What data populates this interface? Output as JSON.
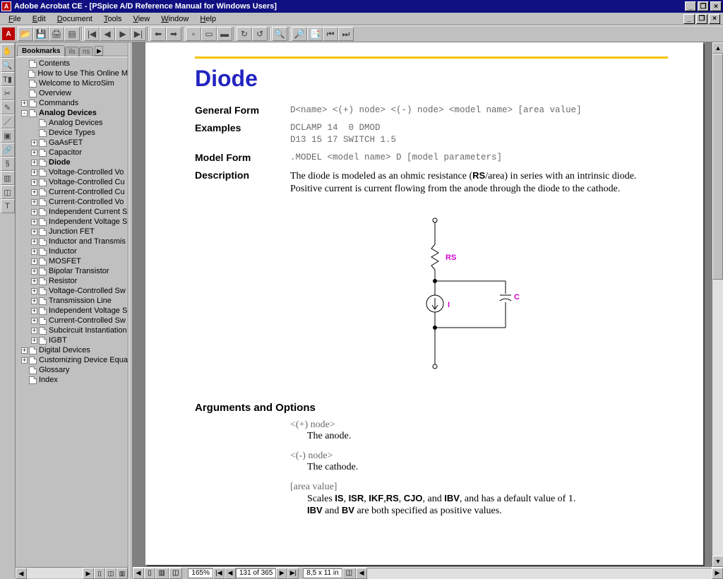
{
  "window": {
    "app": "Adobe Acrobat CE",
    "doc_title": "[PSpice A/D Reference Manual for Windows Users]"
  },
  "menus": [
    "File",
    "Edit",
    "Document",
    "Tools",
    "View",
    "Window",
    "Help"
  ],
  "toolbar_icons": [
    "open",
    "save",
    "print",
    "scan",
    "|",
    "first",
    "prev",
    "next",
    "last",
    "|",
    "back",
    "fwd",
    "|",
    "page",
    "fit",
    "fit-h",
    "|",
    "refresh",
    "refresh2",
    "|",
    "find",
    "|",
    "web1",
    "web2",
    "web3",
    "web4"
  ],
  "vtools": [
    "hand",
    "zoom",
    "select-text",
    "crop",
    "note",
    "pencil",
    "stamp",
    "link",
    "thread",
    "form",
    "article",
    "text-touch"
  ],
  "bookmarks": {
    "tab_active": "Bookmarks",
    "tab_other": "ils",
    "items": [
      {
        "d": 0,
        "t": "",
        "l": "Contents"
      },
      {
        "d": 0,
        "t": "",
        "l": "How to Use This Online M"
      },
      {
        "d": 0,
        "t": "",
        "l": "Welcome to MicroSim"
      },
      {
        "d": 0,
        "t": "",
        "l": "Overview"
      },
      {
        "d": 0,
        "t": "+",
        "l": "Commands"
      },
      {
        "d": 0,
        "t": "-",
        "l": "Analog Devices",
        "b": true
      },
      {
        "d": 1,
        "t": "",
        "l": "Analog Devices"
      },
      {
        "d": 1,
        "t": "",
        "l": "Device Types"
      },
      {
        "d": 1,
        "t": "+",
        "l": "GaAsFET"
      },
      {
        "d": 1,
        "t": "+",
        "l": "Capacitor"
      },
      {
        "d": 1,
        "t": "+",
        "l": "Diode",
        "b": true
      },
      {
        "d": 1,
        "t": "+",
        "l": "Voltage-Controlled Vo"
      },
      {
        "d": 1,
        "t": "+",
        "l": "Voltage-Controlled Cu"
      },
      {
        "d": 1,
        "t": "+",
        "l": "Current-Controlled Cu"
      },
      {
        "d": 1,
        "t": "+",
        "l": "Current-Controlled Vo"
      },
      {
        "d": 1,
        "t": "+",
        "l": "Independent Current S"
      },
      {
        "d": 1,
        "t": "+",
        "l": "Independent Voltage S"
      },
      {
        "d": 1,
        "t": "+",
        "l": "Junction FET"
      },
      {
        "d": 1,
        "t": "+",
        "l": "Inductor and Transmis"
      },
      {
        "d": 1,
        "t": "+",
        "l": "Inductor"
      },
      {
        "d": 1,
        "t": "+",
        "l": "MOSFET"
      },
      {
        "d": 1,
        "t": "+",
        "l": "Bipolar Transistor"
      },
      {
        "d": 1,
        "t": "+",
        "l": "Resistor"
      },
      {
        "d": 1,
        "t": "+",
        "l": "Voltage-Controlled Sw"
      },
      {
        "d": 1,
        "t": "+",
        "l": "Transmission Line"
      },
      {
        "d": 1,
        "t": "+",
        "l": "Independent Voltage S"
      },
      {
        "d": 1,
        "t": "+",
        "l": "Current-Controlled Sw"
      },
      {
        "d": 1,
        "t": "+",
        "l": "Subcircuit Instantiation"
      },
      {
        "d": 1,
        "t": "+",
        "l": "IGBT"
      },
      {
        "d": 0,
        "t": "+",
        "l": "Digital Devices"
      },
      {
        "d": 0,
        "t": "+",
        "l": "Customizing Device Equa"
      },
      {
        "d": 0,
        "t": "",
        "l": "Glossary"
      },
      {
        "d": 0,
        "t": "",
        "l": "Index"
      }
    ]
  },
  "page": {
    "title": "Diode",
    "rows": {
      "general_form_label": "General Form",
      "general_form": "D<name> <(+) node> <(-) node> <model name> [area value]",
      "examples_label": "Examples",
      "examples": "DCLAMP 14  0 DMOD\nD13 15 17 SWITCH 1.5",
      "model_form_label": "Model Form",
      "model_form": ".MODEL <model name> D [model parameters]",
      "description_label": "Description",
      "description_1": "The diode is modeled as an ohmic resistance (",
      "description_rs": "RS",
      "description_2": "/area) in series with an intrinsic diode. Positive current is current flowing from the anode through the diode to the cathode."
    },
    "diagram_labels": {
      "rs": "RS",
      "i": "I",
      "c": "C"
    },
    "args_heading": "Arguments and Options",
    "args": [
      {
        "title": "<(+) node>",
        "desc": "The anode."
      },
      {
        "title": "<(-) node>",
        "desc": "The cathode."
      }
    ],
    "area": {
      "title": "[area value]",
      "line1a": "Scales ",
      "bold1": "IS",
      "sep1": ", ",
      "bold2": "ISR",
      "sep2": ", ",
      "bold3": "IKF",
      "sep3": ",",
      "bold4": "RS",
      "sep4": ", ",
      "bold5": "CJO",
      "sep5": ", and ",
      "bold6": "IBV",
      "line1b": ", and has a default value of 1.",
      "line2a": "",
      "bold7": "IBV",
      "sep6": " and ",
      "bold8": "BV",
      "line2b": " are both specified as positive values."
    }
  },
  "status": {
    "zoom": "165%",
    "page": "131 of 365",
    "size": "8,5 x 11 in"
  }
}
